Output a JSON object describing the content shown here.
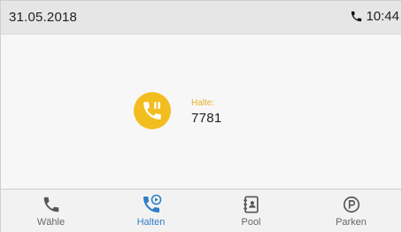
{
  "status_bar": {
    "date": "31.05.2018",
    "time": "10:44",
    "phone_icon": "phone-icon"
  },
  "call": {
    "state_label": "Halte:",
    "number": "7781",
    "icon": "call-hold-icon",
    "accent_color": "#f2be1f"
  },
  "nav": {
    "items": [
      {
        "label": "Wähle",
        "icon": "phone-icon",
        "active": false
      },
      {
        "label": "Halten",
        "icon": "call-hold-icon",
        "active": true
      },
      {
        "label": "Pool",
        "icon": "contacts-book-icon",
        "active": false
      },
      {
        "label": "Parken",
        "icon": "park-icon",
        "active": false
      }
    ],
    "active_color": "#2f7fc6"
  }
}
